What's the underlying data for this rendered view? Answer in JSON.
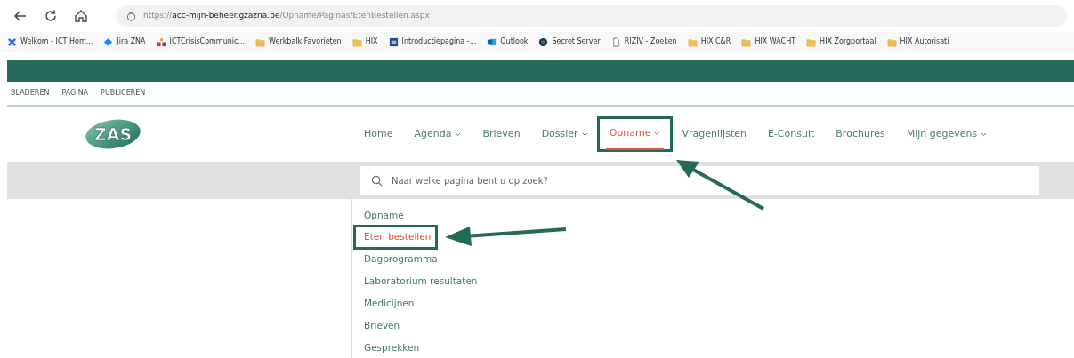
{
  "browser": {
    "url": {
      "scheme": "https://",
      "host": "acc-mijn-beheer.gzazna.be",
      "path": "/Opname/Paginas/EtenBestellen.aspx"
    },
    "bookmarks": [
      {
        "label": "Welkom - ICT Hom...",
        "kind": "cross"
      },
      {
        "label": "Jira ZNA",
        "kind": "diamond"
      },
      {
        "label": "ICTCrisisCommunic...",
        "kind": "people"
      },
      {
        "label": "Werkbalk Favorieten",
        "kind": "folder"
      },
      {
        "label": "HIX",
        "kind": "folder"
      },
      {
        "label": "Introductiepagina -...",
        "kind": "square"
      },
      {
        "label": "Outlook",
        "kind": "mail"
      },
      {
        "label": "Secret Server",
        "kind": "circle"
      },
      {
        "label": "RIZIV - Zoeken",
        "kind": "page"
      },
      {
        "label": "HIX C&R",
        "kind": "folder"
      },
      {
        "label": "HIX WACHT",
        "kind": "folder"
      },
      {
        "label": "HIX Zorgportaal",
        "kind": "folder"
      },
      {
        "label": "HIX Autorisati",
        "kind": "folder"
      }
    ]
  },
  "ribbon_tabs": [
    "BLADEREN",
    "PAGINA",
    "PUBLICEREN"
  ],
  "logo": "ZAS",
  "nav": [
    {
      "label": "Home",
      "dropdown": false,
      "selected": false,
      "highlighted": false
    },
    {
      "label": "Agenda",
      "dropdown": true,
      "selected": false,
      "highlighted": false
    },
    {
      "label": "Brieven",
      "dropdown": false,
      "selected": false,
      "highlighted": false
    },
    {
      "label": "Dossier",
      "dropdown": true,
      "selected": false,
      "highlighted": false
    },
    {
      "label": "Opname",
      "dropdown": true,
      "selected": true,
      "highlighted": true
    },
    {
      "label": "Vragenlijsten",
      "dropdown": false,
      "selected": false,
      "highlighted": false
    },
    {
      "label": "E-Consult",
      "dropdown": false,
      "selected": false,
      "highlighted": false
    },
    {
      "label": "Brochures",
      "dropdown": false,
      "selected": false,
      "highlighted": false
    },
    {
      "label": "Mijn gegevens",
      "dropdown": true,
      "selected": false,
      "highlighted": false
    }
  ],
  "search": {
    "placeholder": "Naar welke pagina bent u op zoek?"
  },
  "submenu": [
    {
      "label": "Opname",
      "selected": false,
      "highlighted": false
    },
    {
      "label": "Eten bestellen",
      "selected": true,
      "highlighted": true
    },
    {
      "label": "Dagprogramma",
      "selected": false,
      "highlighted": false
    },
    {
      "label": "Laboratorium resultaten",
      "selected": false,
      "highlighted": false
    },
    {
      "label": "Medicijnen",
      "selected": false,
      "highlighted": false
    },
    {
      "label": "Brieven",
      "selected": false,
      "highlighted": false
    },
    {
      "label": "Gesprekken",
      "selected": false,
      "highlighted": false
    }
  ]
}
